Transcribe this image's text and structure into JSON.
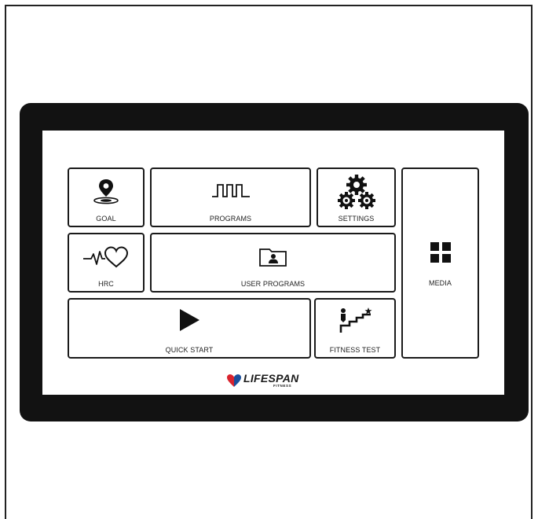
{
  "tiles": {
    "goal": {
      "label": "GOAL",
      "icon": "location-pin-icon"
    },
    "programs": {
      "label": "PROGRAMS",
      "icon": "program-profile-icon"
    },
    "settings": {
      "label": "SETTINGS",
      "icon": "gears-icon"
    },
    "media": {
      "label": "MEDIA",
      "icon": "grid-icon"
    },
    "hrc": {
      "label": "HRC",
      "icon": "heart-rate-icon"
    },
    "user_programs": {
      "label": "USER PROGRAMS",
      "icon": "user-folder-icon"
    },
    "quick_start": {
      "label": "QUICK START",
      "icon": "play-icon"
    },
    "fitness_test": {
      "label": "FITNESS TEST",
      "icon": "stairs-star-icon"
    }
  },
  "brand": {
    "name": "LIFESPAN",
    "subtitle": "FITNESS",
    "colors": {
      "red": "#d9232e",
      "blue": "#1b4f9c"
    }
  },
  "colors": {
    "bezel": "#121212",
    "tile_border": "#1a1a1a",
    "screen": "#ffffff"
  }
}
